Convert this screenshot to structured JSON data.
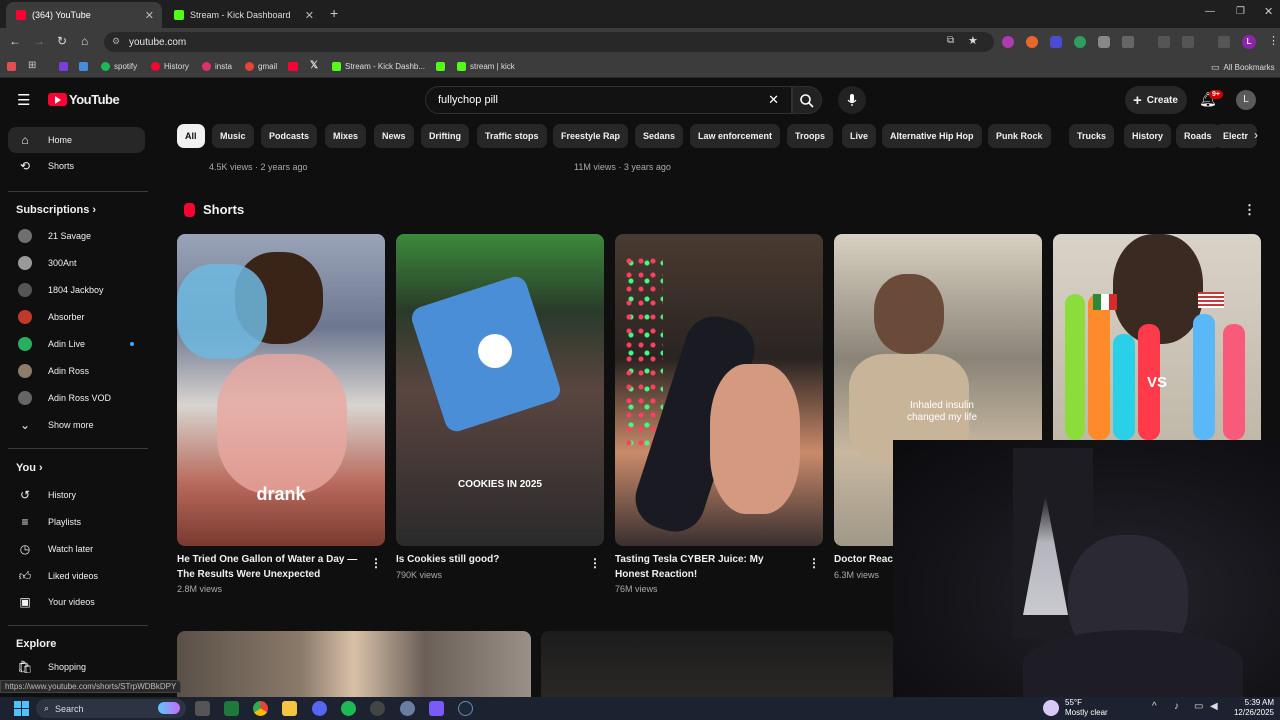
{
  "browser": {
    "tabs": [
      {
        "label": "(364) YouTube",
        "active": true,
        "color": "#ff0033"
      },
      {
        "label": "Stream - Kick Dashboard",
        "active": false,
        "color": "#53fc18"
      }
    ],
    "new_tab": "+",
    "url": "youtube.com",
    "bookmarks": [
      {
        "label": "spotify",
        "color": "#1db954"
      },
      {
        "label": "History",
        "color": "#ff0033"
      },
      {
        "label": "insta",
        "color": "#e1306c"
      },
      {
        "label": "gmail",
        "color": "#ea4335"
      },
      {
        "label": "Stream - Kick Dashb...",
        "color": "#53fc18"
      },
      {
        "label": "stream | kick",
        "color": "#53fc18"
      }
    ],
    "all_bookmarks": "All Bookmarks",
    "profile_initial": "L"
  },
  "youtube": {
    "logo": "YouTube",
    "search_query": "fullychop pill",
    "create_label": "Create",
    "notif_badge": "9+",
    "avatar_initial": "L",
    "chips": [
      "All",
      "Music",
      "Podcasts",
      "Mixes",
      "News",
      "Drifting",
      "Traffic stops",
      "Freestyle Rap",
      "Sedans",
      "Law enforcement",
      "Troops",
      "Live",
      "Alternative Hip Hop",
      "Punk Rock",
      "Trucks",
      "History",
      "Roads",
      "Electr"
    ],
    "prev_meta": [
      "4.5K views · 2 years ago",
      "11M views · 3 years ago"
    ],
    "shorts_label": "Shorts",
    "shorts": [
      {
        "title": "He Tried One Gallon of Water a Day — The Results Were Unexpected",
        "views": "2.8M views",
        "overlay": "drank"
      },
      {
        "title": "Is Cookies still good?",
        "views": "790K views",
        "overlay": "COOKIES IN 2025"
      },
      {
        "title": "Tasting Tesla CYBER Juice: My Honest Reaction!",
        "views": "76M views",
        "overlay": ""
      },
      {
        "title": "Doctor Reac",
        "views": "6.3M views",
        "overlay": "Inhaled insulin changed my life"
      },
      {
        "title": "",
        "views": "",
        "overlay": "VS"
      }
    ]
  },
  "sidebar": {
    "main": [
      {
        "label": "Home",
        "icon": "home-icon"
      },
      {
        "label": "Shorts",
        "icon": "shorts-icon"
      }
    ],
    "subscriptions_heading": "Subscriptions",
    "subscriptions": [
      {
        "label": "21 Savage",
        "color": "#777"
      },
      {
        "label": "300Ant",
        "color": "#999"
      },
      {
        "label": "1804 Jackboy",
        "color": "#555"
      },
      {
        "label": "Absorber",
        "color": "#c0392b"
      },
      {
        "label": "Adin Live",
        "color": "#27ae60"
      },
      {
        "label": "Adin Ross",
        "color": "#8e7b6a"
      },
      {
        "label": "Adin Ross VOD",
        "color": "#666"
      }
    ],
    "show_more": "Show more",
    "you_heading": "You",
    "you_items": [
      {
        "label": "History",
        "icon": "history-icon"
      },
      {
        "label": "Playlists",
        "icon": "playlists-icon"
      },
      {
        "label": "Watch later",
        "icon": "watch-later-icon"
      },
      {
        "label": "Liked videos",
        "icon": "liked-videos-icon"
      },
      {
        "label": "Your videos",
        "icon": "your-videos-icon"
      }
    ],
    "explore_heading": "Explore",
    "explore_items": [
      {
        "label": "Shopping",
        "icon": "shopping-icon"
      }
    ]
  },
  "status_url": "https://www.youtube.com/shorts/STrpWDBkDPY",
  "taskbar": {
    "search": "Search",
    "weather_temp": "55°F",
    "weather_desc": "Mostly clear",
    "time": "5:39 AM",
    "date": "12/26/2025"
  }
}
